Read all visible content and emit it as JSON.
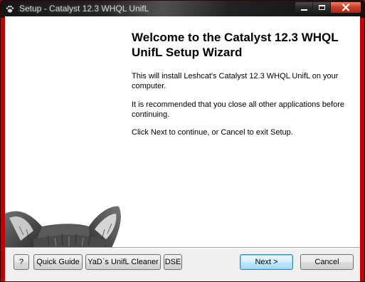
{
  "window": {
    "title": "Setup - Catalyst 12.3 WHQL UnifL",
    "app_icon": "setup-paw-icon",
    "controls": {
      "minimize_icon": "minimize-icon",
      "maximize_icon": "maximize-icon",
      "close_icon": "close-icon"
    }
  },
  "welcome": {
    "heading": "Welcome to the Catalyst 12.3 WHQL UnifL Setup Wizard",
    "paragraphs": [
      "This will install Leshcat's Catalyst 12.3 WHQL UnifL on your computer.",
      "It is recommended that you close all other applications before continuing.",
      "Click Next to continue, or Cancel to exit Setup."
    ],
    "image_icon": "peeking-cat-image"
  },
  "buttons": {
    "help": "?",
    "quick_guide": "Quick Guide",
    "unifl_cleaner": "YaD`s UnifL Cleaner",
    "dse": "DSE",
    "next": "Next >",
    "cancel": "Cancel"
  },
  "colors": {
    "frame_accent": "#c20000",
    "close_button": "#c8422c",
    "default_button_border": "#3c7fb1"
  }
}
